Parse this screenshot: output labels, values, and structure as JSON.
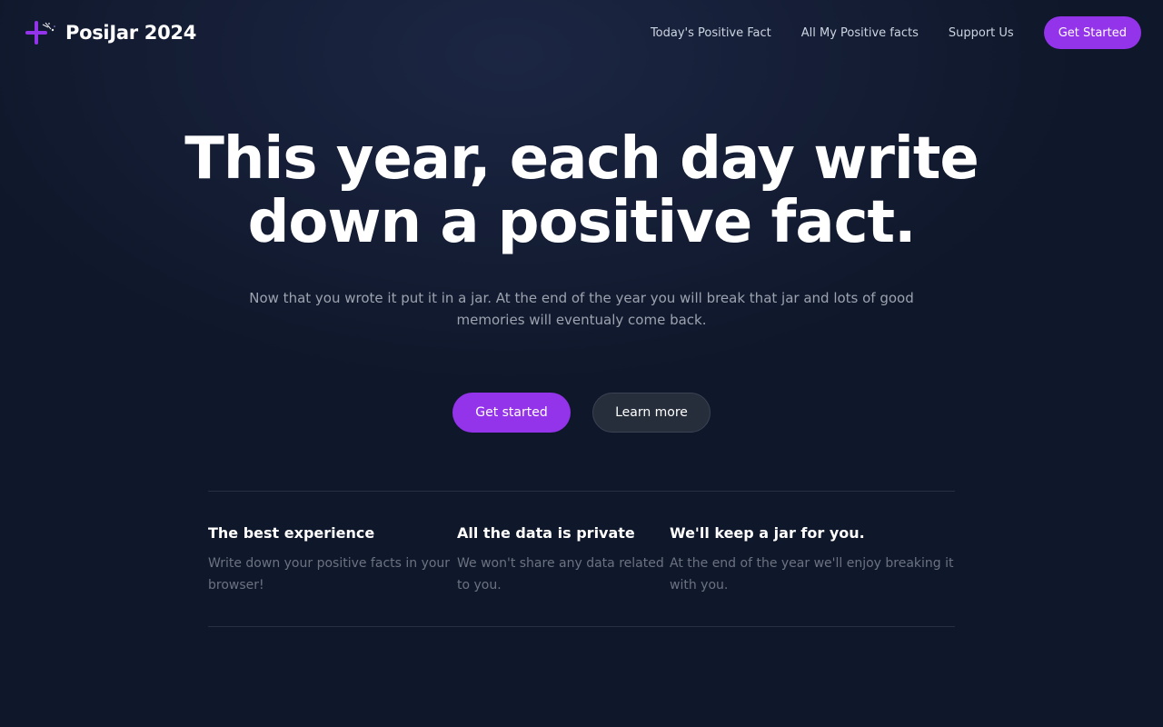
{
  "header": {
    "logo_icon": "sparkle-plus-icon",
    "brand": "PosiJar 2024",
    "nav": [
      {
        "label": "Today's Positive Fact"
      },
      {
        "label": "All My Positive facts"
      },
      {
        "label": "Support Us"
      }
    ],
    "cta_label": "Get Started"
  },
  "hero": {
    "title": "This year, each day write down a positive fact.",
    "subtitle": "Now that you wrote it put it in a jar. At the end of the year you will break that jar and lots of good memories will eventualy come back.",
    "primary_label": "Get started",
    "secondary_label": "Learn more"
  },
  "features": [
    {
      "title": "The best experience",
      "description": "Write down your positive facts in your browser!"
    },
    {
      "title": "All the data is private",
      "description": "We won't share any data related to you."
    },
    {
      "title": "We'll keep a jar for you.",
      "description": "At the end of the year we'll enjoy breaking it with you."
    }
  ],
  "colors": {
    "background": "#0f172a",
    "accent": "#9333ea",
    "secondary_button": "#262d3b",
    "muted_text": "#9ca3af"
  }
}
